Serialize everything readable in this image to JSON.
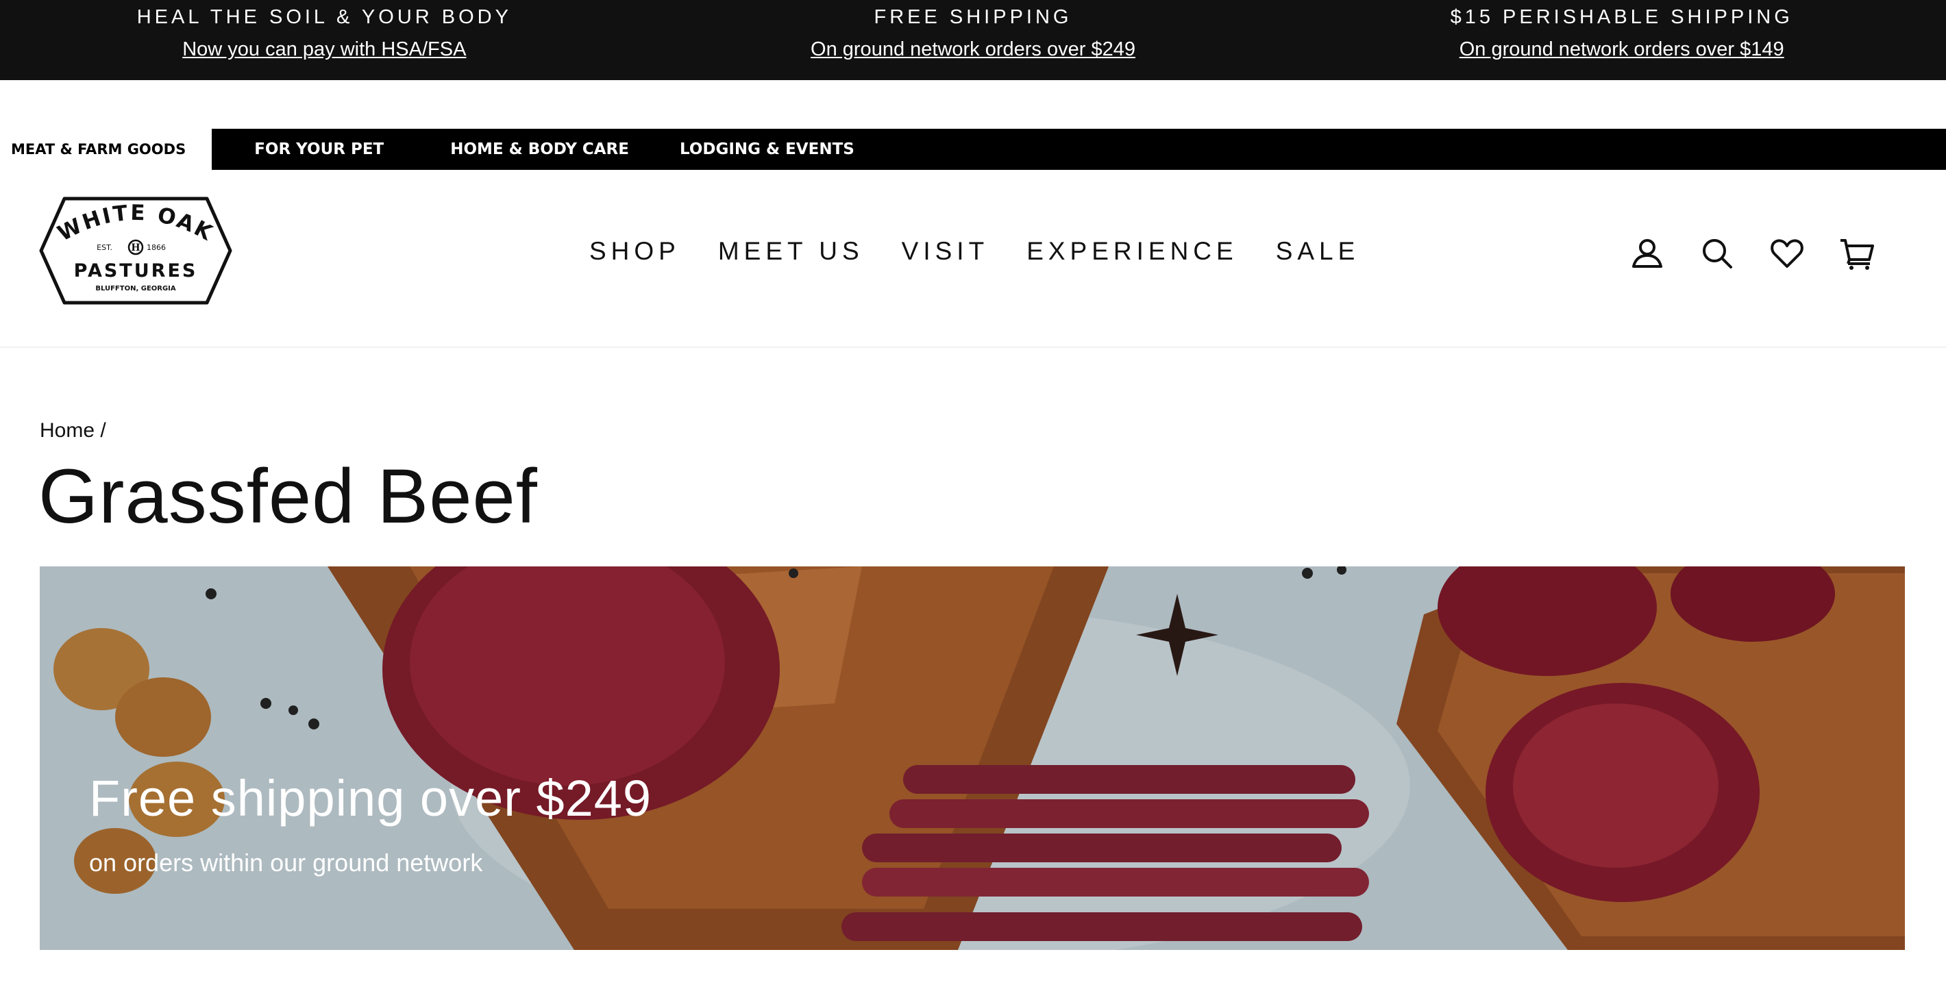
{
  "announcement": [
    {
      "title": "HEAL THE SOIL & YOUR BODY",
      "link": "Now you can pay with HSA/FSA"
    },
    {
      "title": "FREE SHIPPING",
      "link": "On ground network orders over $249"
    },
    {
      "title": "$15 PERISHABLE SHIPPING",
      "link": "On ground network orders over $149"
    }
  ],
  "store_tabs": [
    "MEAT & FARM GOODS",
    "FOR YOUR PET",
    "HOME & BODY CARE",
    "LODGING & EVENTS"
  ],
  "logo": {
    "line1": "WHITE OAK",
    "est": "EST.",
    "year": "1866",
    "monogram": "H",
    "line2": "PASTURES",
    "line3": "BLUFFTON, GEORGIA"
  },
  "nav": [
    "SHOP",
    "MEET US",
    "VISIT",
    "EXPERIENCE",
    "SALE"
  ],
  "header_icons": [
    "account-icon",
    "search-icon",
    "heart-icon",
    "cart-icon"
  ],
  "breadcrumb": {
    "home": "Home",
    "separator": "/"
  },
  "page_title": "Grassfed Beef",
  "hero": {
    "title": "Free shipping over $249",
    "subtitle": "on orders within our ground network"
  },
  "colors": {
    "announce_bg": "#111111",
    "store_bar_bg": "#000000",
    "text": "#111111"
  }
}
